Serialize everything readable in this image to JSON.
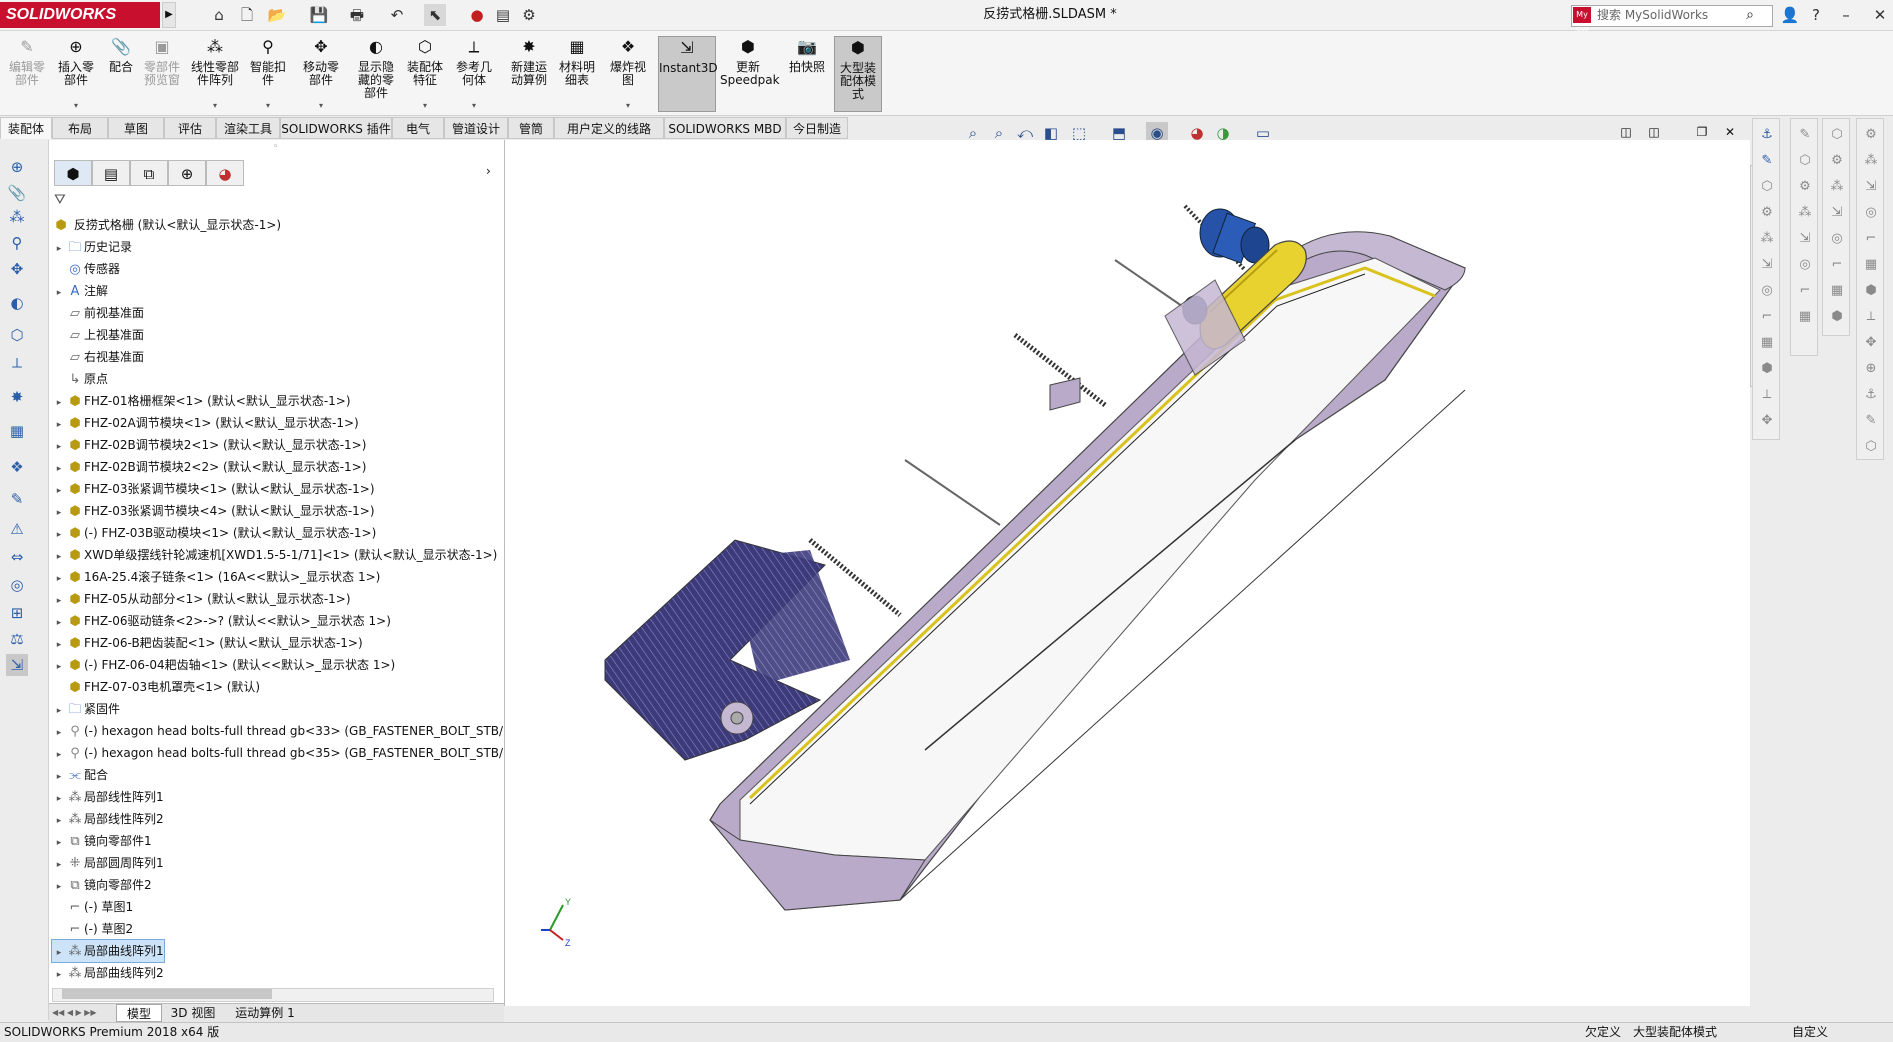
{
  "app": {
    "logo": "SOLIDWORKS",
    "document_title": "反捞式格栅.SLDASM *"
  },
  "search": {
    "placeholder": "搜索 MySolidWorks",
    "logo_text": "My SW"
  },
  "quick_access": [
    {
      "name": "home-icon",
      "glyph": "⌂"
    },
    {
      "name": "new-file-icon",
      "glyph": "🗋"
    },
    {
      "name": "open-file-icon",
      "glyph": "📂"
    },
    {
      "name": "save-icon",
      "glyph": "💾"
    },
    {
      "name": "print-icon",
      "glyph": "🖶"
    },
    {
      "name": "undo-icon",
      "glyph": "↶"
    },
    {
      "name": "select-icon",
      "glyph": "⬉"
    },
    {
      "name": "traffic-light-icon",
      "glyph": "●"
    },
    {
      "name": "file-properties-icon",
      "glyph": "▤"
    },
    {
      "name": "options-gear-icon",
      "glyph": "⚙"
    }
  ],
  "ribbon": [
    {
      "label1": "编辑零",
      "label2": "部件",
      "disabled": true,
      "icon": "edit-component-icon",
      "glyph": "✎"
    },
    {
      "label1": "插入零",
      "label2": "部件",
      "disabled": false,
      "icon": "insert-component-icon",
      "glyph": "⊕"
    },
    {
      "label1": "配合",
      "label2": "",
      "disabled": false,
      "icon": "mate-icon",
      "glyph": "📎"
    },
    {
      "label1": "零部件",
      "label2": "预览窗",
      "disabled": true,
      "icon": "component-preview-icon",
      "glyph": "▣"
    },
    {
      "label1": "线性零部",
      "label2": "件阵列",
      "disabled": false,
      "icon": "linear-pattern-icon",
      "glyph": "⁂"
    },
    {
      "label1": "智能扣",
      "label2": "件",
      "disabled": false,
      "icon": "smart-fastener-icon",
      "glyph": "⚲"
    },
    {
      "label1": "移动零",
      "label2": "部件",
      "disabled": false,
      "icon": "move-component-icon",
      "glyph": "✥"
    },
    {
      "label1": "显示隐",
      "label2": "藏的零",
      "label3": "部件",
      "disabled": false,
      "icon": "show-hidden-icon",
      "glyph": "◐"
    },
    {
      "label1": "装配体",
      "label2": "特征",
      "disabled": false,
      "icon": "assembly-feature-icon",
      "glyph": "⬡"
    },
    {
      "label1": "参考几",
      "label2": "何体",
      "disabled": false,
      "icon": "reference-geometry-icon",
      "glyph": "⟂"
    },
    {
      "label1": "新建运",
      "label2": "动算例",
      "disabled": false,
      "icon": "new-motion-study-icon",
      "glyph": "✸"
    },
    {
      "label1": "材料明",
      "label2": "细表",
      "disabled": false,
      "icon": "bom-icon",
      "glyph": "▦"
    },
    {
      "label1": "爆炸视",
      "label2": "图",
      "disabled": false,
      "icon": "exploded-view-icon",
      "glyph": "❖"
    },
    {
      "label1": "Instant3D",
      "label2": "",
      "disabled": false,
      "active": true,
      "icon": "instant3d-icon",
      "glyph": "⇲"
    },
    {
      "label1": "更新",
      "label2": "Speedpak",
      "disabled": false,
      "icon": "speedpak-icon",
      "glyph": "⬢"
    },
    {
      "label1": "拍快照",
      "label2": "",
      "disabled": false,
      "icon": "snapshot-icon",
      "glyph": "📷"
    },
    {
      "label1": "大型装",
      "label2": "配体模",
      "label3": "式",
      "disabled": false,
      "active": true,
      "icon": "large-assembly-icon",
      "glyph": "⬢"
    }
  ],
  "tabs": [
    "装配体",
    "布局",
    "草图",
    "评估",
    "渲染工具",
    "SOLIDWORKS 插件",
    "电气",
    "管道设计",
    "管筒",
    "用户定义的线路",
    "SOLIDWORKS MBD",
    "今日制造"
  ],
  "feature_tree": {
    "root": "反捞式格栅 (默认<默认_显示状态-1>)",
    "items": [
      {
        "label": "历史记录",
        "type": "folder",
        "glyph": "🗀",
        "exp": true
      },
      {
        "label": "传感器",
        "type": "folder",
        "glyph": "◎",
        "exp": false
      },
      {
        "label": "注解",
        "type": "folder",
        "glyph": "A",
        "exp": true
      },
      {
        "label": "前视基准面",
        "type": "plane",
        "glyph": "▱",
        "exp": false
      },
      {
        "label": "上视基准面",
        "type": "plane",
        "glyph": "▱",
        "exp": false
      },
      {
        "label": "右视基准面",
        "type": "plane",
        "glyph": "▱",
        "exp": false
      },
      {
        "label": "原点",
        "type": "plane",
        "glyph": "↳",
        "exp": false
      },
      {
        "label": "FHZ-01格栅框架<1> (默认<默认_显示状态-1>)",
        "type": "part",
        "glyph": "⬢",
        "exp": true
      },
      {
        "label": "FHZ-02A调节模块<1> (默认<默认_显示状态-1>)",
        "type": "part",
        "glyph": "⬢",
        "exp": true
      },
      {
        "label": "FHZ-02B调节模块2<1> (默认<默认_显示状态-1>)",
        "type": "part",
        "glyph": "⬢",
        "exp": true
      },
      {
        "label": "FHZ-02B调节模块2<2> (默认<默认_显示状态-1>)",
        "type": "part",
        "glyph": "⬢",
        "exp": true
      },
      {
        "label": "FHZ-03张紧调节模块<1> (默认<默认_显示状态-1>)",
        "type": "part",
        "glyph": "⬢",
        "exp": true
      },
      {
        "label": "FHZ-03张紧调节模块<4> (默认<默认_显示状态-1>)",
        "type": "part",
        "glyph": "⬢",
        "exp": true
      },
      {
        "label": "(-) FHZ-03B驱动模块<1> (默认<默认_显示状态-1>)",
        "type": "part",
        "glyph": "⬢",
        "exp": true
      },
      {
        "label": "XWD单级摆线针轮减速机[XWD1.5-5-1/71]<1> (默认<默认_显示状态-1>)",
        "type": "part",
        "glyph": "⬢",
        "exp": true
      },
      {
        "label": "16A-25.4滚子链条<1> (16A<<默认>_显示状态 1>)",
        "type": "part",
        "glyph": "⬢",
        "exp": true
      },
      {
        "label": "FHZ-05从动部分<1> (默认<默认_显示状态-1>)",
        "type": "part",
        "glyph": "⬢",
        "exp": true
      },
      {
        "label": "FHZ-06驱动链条<2>->? (默认<<默认>_显示状态 1>)",
        "type": "part",
        "glyph": "⬢",
        "exp": true
      },
      {
        "label": "FHZ-06-B耙齿装配<1> (默认<默认_显示状态-1>)",
        "type": "part",
        "glyph": "⬢",
        "exp": true
      },
      {
        "label": "(-) FHZ-06-04耙齿轴<1> (默认<<默认>_显示状态 1>)",
        "type": "part",
        "glyph": "⬢",
        "exp": true
      },
      {
        "label": "FHZ-07-03电机罩壳<1> (默认)",
        "type": "part",
        "glyph": "⬢",
        "exp": false
      },
      {
        "label": "紧固件",
        "type": "folder",
        "glyph": "🗀",
        "exp": true
      },
      {
        "label": "(-) hexagon head bolts-full thread gb<33> (GB_FASTENER_BOLT_STB/",
        "type": "fast",
        "glyph": "⚲",
        "exp": true
      },
      {
        "label": "(-) hexagon head bolts-full thread gb<35> (GB_FASTENER_BOLT_STB/",
        "type": "fast",
        "glyph": "⚲",
        "exp": true
      },
      {
        "label": "配合",
        "type": "folder",
        "glyph": "⫘",
        "exp": true
      },
      {
        "label": "局部线性阵列1",
        "type": "plane",
        "glyph": "⁂",
        "exp": true
      },
      {
        "label": "局部线性阵列2",
        "type": "plane",
        "glyph": "⁂",
        "exp": true
      },
      {
        "label": "镜向零部件1",
        "type": "plane",
        "glyph": "⧉",
        "exp": true
      },
      {
        "label": "局部圆周阵列1",
        "type": "plane",
        "glyph": "⁜",
        "exp": true
      },
      {
        "label": "镜向零部件2",
        "type": "plane",
        "glyph": "⧉",
        "exp": true
      },
      {
        "label": "(-) 草图1",
        "type": "plane",
        "glyph": "⌐",
        "exp": false
      },
      {
        "label": "(-) 草图2",
        "type": "plane",
        "glyph": "⌐",
        "exp": false
      },
      {
        "label": "局部曲线阵列1",
        "type": "plane",
        "glyph": "⁂",
        "exp": true,
        "selected": true
      },
      {
        "label": "局部曲线阵列2",
        "type": "plane",
        "glyph": "⁂",
        "exp": true
      }
    ]
  },
  "bottom_tabs": [
    "模型",
    "3D 视图",
    "运动算例 1"
  ],
  "status": {
    "product": "SOLIDWORKS Premium 2018 x64 版",
    "state": "欠定义",
    "mode": "大型装配体模式",
    "custom": "自定义"
  },
  "colors": {
    "brand": "#c8102e",
    "frame": "#b4a6c4",
    "screen_mesh": "#3d3a7a",
    "motor_blue": "#2653a8",
    "gearbox_yellow": "#e8d230"
  }
}
